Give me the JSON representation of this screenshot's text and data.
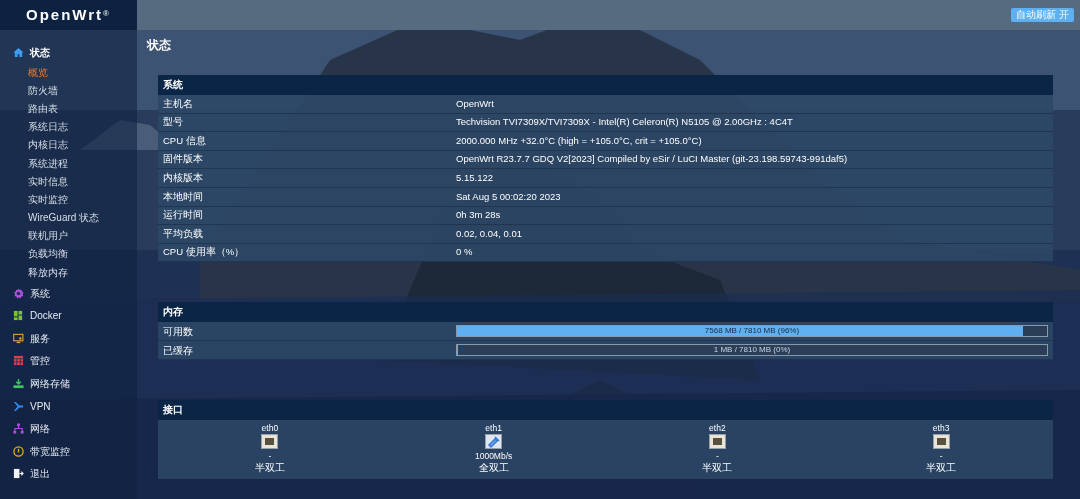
{
  "header": {
    "logo": "OpenWrt",
    "logo_mark": "®",
    "refresh_button": "自动刷新 开"
  },
  "sidebar": {
    "items": [
      {
        "label": "状态",
        "expanded": true,
        "children": [
          {
            "label": "概览",
            "selected": true
          },
          {
            "label": "防火墙",
            "selected": false
          },
          {
            "label": "路由表",
            "selected": false
          },
          {
            "label": "系统日志",
            "selected": false
          },
          {
            "label": "内核日志",
            "selected": false
          },
          {
            "label": "系统进程",
            "selected": false
          },
          {
            "label": "实时信息",
            "selected": false
          },
          {
            "label": "实时监控",
            "selected": false
          },
          {
            "label": "WireGuard 状态",
            "selected": false
          },
          {
            "label": "联机用户",
            "selected": false
          },
          {
            "label": "负载均衡",
            "selected": false
          },
          {
            "label": "释放内存",
            "selected": false
          }
        ]
      },
      {
        "label": "系统",
        "expanded": false
      },
      {
        "label": "Docker",
        "expanded": false
      },
      {
        "label": "服务",
        "expanded": false
      },
      {
        "label": "管控",
        "expanded": false
      },
      {
        "label": "网络存储",
        "expanded": false
      },
      {
        "label": "VPN",
        "expanded": false
      },
      {
        "label": "网络",
        "expanded": false
      },
      {
        "label": "带宽监控",
        "expanded": false
      },
      {
        "label": "退出",
        "expanded": false
      }
    ]
  },
  "page_title": "状态",
  "system": {
    "title": "系统",
    "rows": [
      {
        "label": "主机名",
        "value": "OpenWrt"
      },
      {
        "label": "型号",
        "value": "Techvision TVI7309X/TVI7309X - Intel(R) Celeron(R) N5105 @ 2.00GHz : 4C4T"
      },
      {
        "label": "CPU 信息",
        "value": "2000.000 MHz +32.0°C (high = +105.0°C, crit = +105.0°C)"
      },
      {
        "label": "固件版本",
        "value": "OpenWrt R23.7.7 GDQ V2[2023] Compiled by eSir / LuCI Master (git-23.198.59743-991daf5)"
      },
      {
        "label": "内核版本",
        "value": "5.15.122"
      },
      {
        "label": "本地时间",
        "value": "Sat Aug 5 00:02:20 2023"
      },
      {
        "label": "运行时间",
        "value": "0h 3m 28s"
      },
      {
        "label": "平均负载",
        "value": "0.02, 0.04, 0.01"
      },
      {
        "label": "CPU 使用率（%）",
        "value": "0 %"
      }
    ]
  },
  "memory": {
    "title": "内存",
    "rows": [
      {
        "label": "可用数",
        "level": 0.96,
        "reading": "7568 MB / 7810 MB (96%)"
      },
      {
        "label": "已缓存",
        "level": 0.0,
        "reading": "1 MB / 7810 MB (0%)"
      }
    ]
  },
  "interfaces": {
    "title": "接口",
    "ports": [
      {
        "name": "eth0",
        "connected": false,
        "speed": "-",
        "duplex": "半双工"
      },
      {
        "name": "eth1",
        "connected": true,
        "speed": "1000Mb/s",
        "duplex": "全双工"
      },
      {
        "name": "eth2",
        "connected": false,
        "speed": "-",
        "duplex": "半双工"
      },
      {
        "name": "eth3",
        "connected": false,
        "speed": "-",
        "duplex": "半双工"
      }
    ]
  }
}
